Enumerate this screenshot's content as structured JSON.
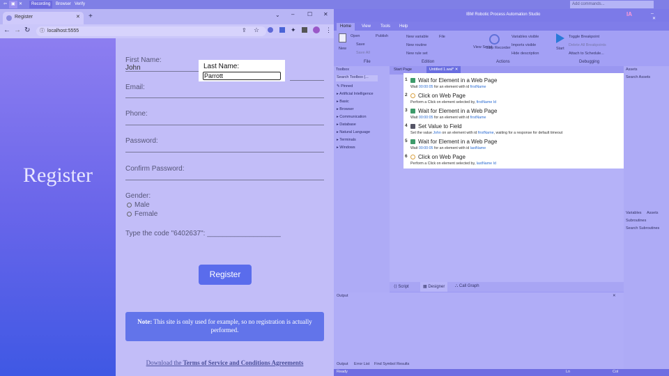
{
  "recorder_bar": {
    "buttons": [
      "Recording",
      "Browser",
      "Verify"
    ],
    "search_placeholder": "Add commands..."
  },
  "browser": {
    "tab_title": "Register",
    "url": "localhost:5555",
    "form": {
      "heading": "Register",
      "first_name_label": "First Name:",
      "first_name_value": "John",
      "last_name_label": "Last Name:",
      "last_name_value": "Parrott",
      "email_label": "Email:",
      "phone_label": "Phone:",
      "password_label": "Password:",
      "confirm_password_label": "Confirm Password:",
      "gender_label": "Gender:",
      "gender_options": [
        "Male",
        "Female"
      ],
      "code_prompt": "Type the code \"6402637\": ___________________",
      "register_button": "Register",
      "note_bold": "Note:",
      "note_text": " This site is only used for example, so no registration is actually performed.",
      "download_prefix": "Download the ",
      "download_link": "Terms of Service and Conditions Agreements"
    }
  },
  "studio": {
    "title": "IBM Robotic Process Automation Studio",
    "title_badge": "IA",
    "ribbon_tabs": [
      "Home",
      "View",
      "Tools",
      "Help"
    ],
    "ribbon": {
      "new": "New",
      "open": "Open",
      "publish": "Publish",
      "save": "Save",
      "save_all": "Save All",
      "new_variable": "New variable",
      "file_menu": "File",
      "new_routine": "New routine",
      "new_rule_set": "New rule set",
      "view_script": "View Script",
      "stop_recorder": "Stop Recorder",
      "variables_visible": "Variables visible",
      "imports_visible": "Imports visible",
      "hide_description": "Hide description",
      "start": "Start",
      "toggle_breakpoint": "Toggle Breakpoint",
      "delete_all_breakpoints": "Delete All Breakpoints",
      "attach_to_schedule": "Attach to Schedule...",
      "groups": [
        "File",
        "Edition",
        "Actions",
        "Debugging"
      ]
    },
    "toolbox": {
      "title": "Toolbox",
      "search_placeholder": "Search Toolbox (...",
      "items": [
        "Pinned",
        "Artificial Intelligence",
        "Basic",
        "Browser",
        "Communication",
        "Database",
        "Natural Language",
        "Terminals",
        "Windows"
      ]
    },
    "doc_tabs": [
      "Start Page",
      "Untitled 1.wal*"
    ],
    "steps": [
      {
        "num": "1",
        "title": "Wait for Element in a Web Page",
        "desc_a": "Wait ",
        "time": "00:00:05",
        "desc_b": " for an element with id ",
        "target": "firstName",
        "icon": "web-wait-icon"
      },
      {
        "num": "2",
        "title": "Click on Web Page",
        "desc_a": "Perform a Click on element selected by, ",
        "time": "",
        "desc_b": "",
        "target": "firstName Id",
        "icon": "click-icon"
      },
      {
        "num": "3",
        "title": "Wait for Element in a Web Page",
        "desc_a": "Wait ",
        "time": "00:00:05",
        "desc_b": " for an element with id ",
        "target": "firstName",
        "icon": "web-wait-icon"
      },
      {
        "num": "4",
        "title": "Set Value to Field",
        "desc_a": "Set the value ",
        "time": "John",
        "desc_b": " on an element with id ",
        "target": "firstName",
        "extra": ", waiting for a response for default timeout",
        "icon": "set-field-icon"
      },
      {
        "num": "5",
        "title": "Wait for Element in a Web Page",
        "desc_a": "Wait ",
        "time": "00:00:05",
        "desc_b": " for an element with id ",
        "target": "lastName",
        "icon": "web-wait-icon"
      },
      {
        "num": "6",
        "title": "Click on Web Page",
        "desc_a": "Perform a Click on element selected by, ",
        "time": "",
        "desc_b": "",
        "target": "lastName Id",
        "icon": "click-icon"
      }
    ],
    "bottom_tabs": [
      "Script",
      "Designer",
      "Call Graph"
    ],
    "output": {
      "title": "Output",
      "tabs": [
        "Output",
        "Error List",
        "Find Symbol Results"
      ]
    },
    "assets": {
      "title": "Assets",
      "search_placeholder": "Search Assets",
      "tabs": [
        "Variables",
        "Assets"
      ],
      "subroutines_title": "Subroutines",
      "subroutines_placeholder": "Search Subroutines"
    },
    "status": {
      "ready": "Ready",
      "ln": "Ln",
      "col": "Col"
    }
  }
}
